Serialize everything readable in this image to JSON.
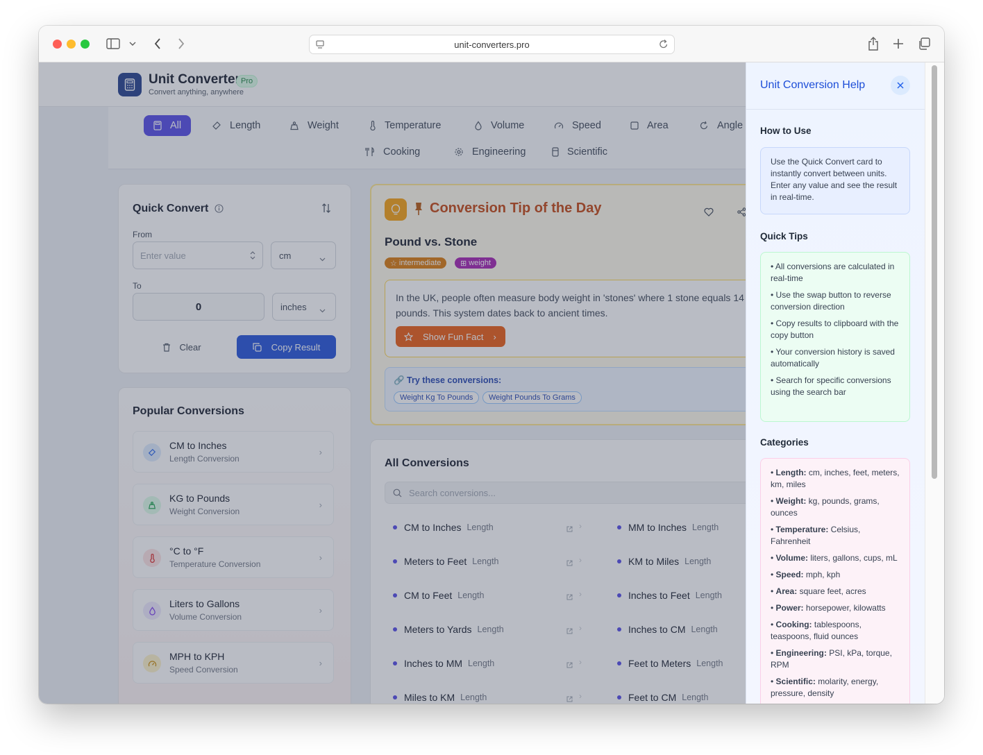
{
  "browser": {
    "url": "unit-converters.pro"
  },
  "header": {
    "brand": "Unit Converter",
    "badge": "Pro",
    "tagline": "Convert anything, anywhere"
  },
  "categories": [
    "All",
    "Length",
    "Weight",
    "Temperature",
    "Volume",
    "Speed",
    "Area",
    "Angle",
    "Cooking",
    "Engineering",
    "Scientific"
  ],
  "quick_convert": {
    "title": "Quick Convert",
    "from_label": "From",
    "from_placeholder": "Enter value",
    "from_unit": "cm",
    "to_label": "To",
    "to_value": "0",
    "to_unit": "inches",
    "clear_label": "Clear",
    "copy_label": "Copy Result"
  },
  "popular": {
    "title": "Popular Conversions",
    "items": [
      {
        "title": "CM to Inches",
        "sub": "Length Conversion",
        "color": "#dbeafe"
      },
      {
        "title": "KG to Pounds",
        "sub": "Weight Conversion",
        "color": "#dcfce7"
      },
      {
        "title": "°C to °F",
        "sub": "Temperature Conversion",
        "color": "#fee2e2"
      },
      {
        "title": "Liters to Gallons",
        "sub": "Volume Conversion",
        "color": "#ede9fe"
      },
      {
        "title": "MPH to KPH",
        "sub": "Speed Conversion",
        "color": "#fef3c7"
      }
    ]
  },
  "tip": {
    "heading": "Conversion Tip of the Day",
    "subject": "Pound vs. Stone",
    "tag1": "intermediate",
    "tag2": "weight",
    "text": "In the UK, people often measure body weight in 'stones' where 1 stone equals 14 pounds. This system dates back to ancient times.",
    "fun_fact": "Show Fun Fact",
    "try_label": "Try these conversions:",
    "try1": "Weight Kg To Pounds",
    "try2": "Weight Pounds To Grams"
  },
  "all": {
    "title": "All Conversions",
    "search_placeholder": "Search conversions...",
    "left": [
      {
        "name": "CM to Inches",
        "cat": "Length"
      },
      {
        "name": "Meters to Feet",
        "cat": "Length"
      },
      {
        "name": "CM to Feet",
        "cat": "Length"
      },
      {
        "name": "Meters to Yards",
        "cat": "Length"
      },
      {
        "name": "Inches to MM",
        "cat": "Length"
      },
      {
        "name": "Miles to KM",
        "cat": "Length"
      }
    ],
    "right": [
      {
        "name": "MM to Inches",
        "cat": "Length"
      },
      {
        "name": "KM to Miles",
        "cat": "Length"
      },
      {
        "name": "Inches to Feet",
        "cat": "Length"
      },
      {
        "name": "Inches to CM",
        "cat": "Length"
      },
      {
        "name": "Feet to Meters",
        "cat": "Length"
      },
      {
        "name": "Feet to CM",
        "cat": "Length"
      }
    ]
  },
  "help": {
    "title": "Unit Conversion Help",
    "how_title": "How to Use",
    "how_text": "Use the Quick Convert card to instantly convert between units. Enter any value and see the result in real-time.",
    "tips_title": "Quick Tips",
    "tips": [
      "• All conversions are calculated in real-time",
      "• Use the swap button to reverse conversion direction",
      "• Copy results to clipboard with the copy button",
      "• Your conversion history is saved automatically",
      "• Search for specific conversions using the search bar"
    ],
    "cats_title": "Categories",
    "cats": [
      {
        "k": "Length:",
        "v": " cm, inches, feet, meters, km, miles"
      },
      {
        "k": "Weight:",
        "v": " kg, pounds, grams, ounces"
      },
      {
        "k": "Temperature:",
        "v": " Celsius, Fahrenheit"
      },
      {
        "k": "Volume:",
        "v": " liters, gallons, cups, mL"
      },
      {
        "k": "Speed:",
        "v": " mph, kph"
      },
      {
        "k": "Area:",
        "v": " square feet, acres"
      },
      {
        "k": "Power:",
        "v": " horsepower, kilowatts"
      },
      {
        "k": "Cooking:",
        "v": " tablespoons, teaspoons, fluid ounces"
      },
      {
        "k": "Engineering:",
        "v": " PSI, kPa, torque, RPM"
      },
      {
        "k": "Scientific:",
        "v": " molarity, energy, pressure, density"
      }
    ]
  }
}
